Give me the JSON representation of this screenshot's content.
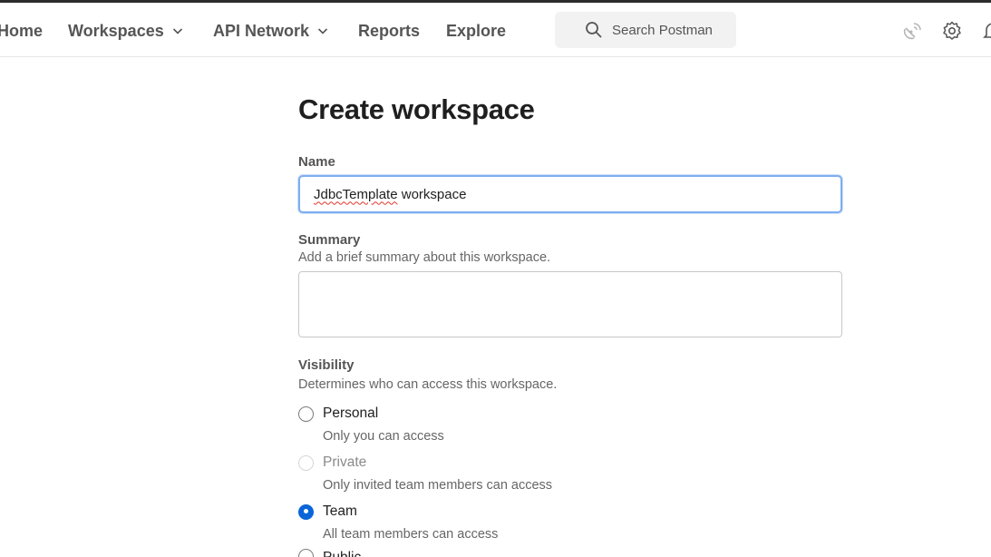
{
  "nav": {
    "home": "Home",
    "workspaces": "Workspaces",
    "api_network": "API Network",
    "reports": "Reports",
    "explore": "Explore",
    "search_placeholder": "Search Postman"
  },
  "form": {
    "title": "Create workspace",
    "name_label": "Name",
    "name_value_word1": "JdbcTemplate",
    "name_value_word2": " workspace",
    "summary_label": "Summary",
    "summary_helper": "Add a brief summary about this workspace.",
    "visibility_label": "Visibility",
    "visibility_helper": "Determines who can access this workspace.",
    "options": [
      {
        "label": "Personal",
        "desc": "Only you can access",
        "state": "unchecked"
      },
      {
        "label": "Private",
        "desc": "Only invited team members can access",
        "state": "disabled"
      },
      {
        "label": "Team",
        "desc": "All team members can access",
        "state": "checked"
      },
      {
        "label": "Public",
        "desc": "",
        "state": "unchecked"
      }
    ]
  },
  "colors": {
    "accent": "#0a66d8",
    "focus_border": "#7eaef0",
    "nav_text": "#555555"
  },
  "icons": [
    "search-icon",
    "chevron-down-icon",
    "satellite-icon",
    "gear-icon",
    "bell-icon"
  ]
}
